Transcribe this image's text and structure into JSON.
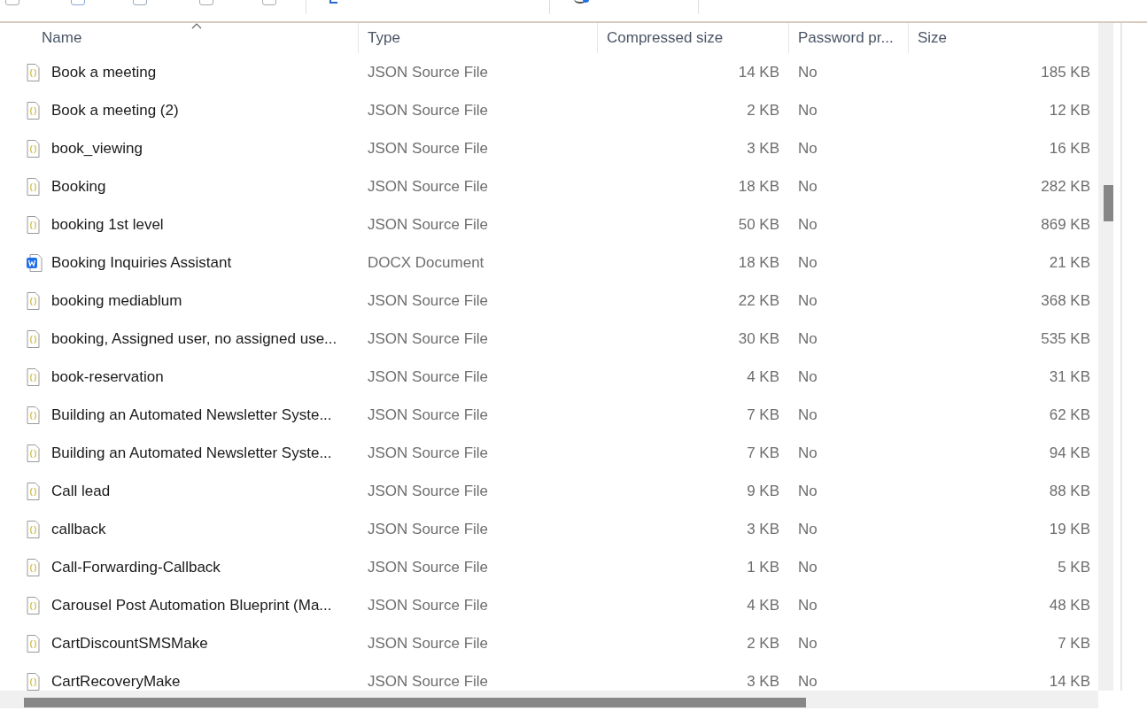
{
  "columns": [
    {
      "label": "Name",
      "sorted": true
    },
    {
      "label": "Type",
      "sorted": false
    },
    {
      "label": "Compressed size",
      "sorted": false
    },
    {
      "label": "Password pr...",
      "sorted": false
    },
    {
      "label": "Size",
      "sorted": false
    }
  ],
  "rows": [
    {
      "kind": "json",
      "name": "Book a meeting",
      "type": "JSON Source File",
      "compressed": "14 KB",
      "password": "No",
      "size": "185 KB"
    },
    {
      "kind": "json",
      "name": "Book a meeting (2)",
      "type": "JSON Source File",
      "compressed": "2 KB",
      "password": "No",
      "size": "12 KB"
    },
    {
      "kind": "json",
      "name": "book_viewing",
      "type": "JSON Source File",
      "compressed": "3 KB",
      "password": "No",
      "size": "16 KB"
    },
    {
      "kind": "json",
      "name": "Booking",
      "type": "JSON Source File",
      "compressed": "18 KB",
      "password": "No",
      "size": "282 KB"
    },
    {
      "kind": "json",
      "name": "booking 1st level",
      "type": "JSON Source File",
      "compressed": "50 KB",
      "password": "No",
      "size": "869 KB"
    },
    {
      "kind": "docx",
      "name": "Booking Inquiries Assistant",
      "type": "DOCX Document",
      "compressed": "18 KB",
      "password": "No",
      "size": "21 KB"
    },
    {
      "kind": "json",
      "name": "booking mediablum",
      "type": "JSON Source File",
      "compressed": "22 KB",
      "password": "No",
      "size": "368 KB"
    },
    {
      "kind": "json",
      "name": "booking, Assigned user, no assigned use...",
      "type": "JSON Source File",
      "compressed": "30 KB",
      "password": "No",
      "size": "535 KB"
    },
    {
      "kind": "json",
      "name": "book-reservation",
      "type": "JSON Source File",
      "compressed": "4 KB",
      "password": "No",
      "size": "31 KB"
    },
    {
      "kind": "json",
      "name": "Building an Automated Newsletter Syste...",
      "type": "JSON Source File",
      "compressed": "7 KB",
      "password": "No",
      "size": "62 KB"
    },
    {
      "kind": "json",
      "name": "Building an Automated Newsletter Syste...",
      "type": "JSON Source File",
      "compressed": "7 KB",
      "password": "No",
      "size": "94 KB"
    },
    {
      "kind": "json",
      "name": "Call lead",
      "type": "JSON Source File",
      "compressed": "9 KB",
      "password": "No",
      "size": "88 KB"
    },
    {
      "kind": "json",
      "name": "callback",
      "type": "JSON Source File",
      "compressed": "3 KB",
      "password": "No",
      "size": "19 KB"
    },
    {
      "kind": "json",
      "name": "Call-Forwarding-Callback",
      "type": "JSON Source File",
      "compressed": "1 KB",
      "password": "No",
      "size": "5 KB"
    },
    {
      "kind": "json",
      "name": "Carousel Post Automation Blueprint (Ma...",
      "type": "JSON Source File",
      "compressed": "4 KB",
      "password": "No",
      "size": "48 KB"
    },
    {
      "kind": "json",
      "name": "CartDiscountSMSMake",
      "type": "JSON Source File",
      "compressed": "2 KB",
      "password": "No",
      "size": "7 KB"
    },
    {
      "kind": "json",
      "name": "CartRecoveryMake",
      "type": "JSON Source File",
      "compressed": "3 KB",
      "password": "No",
      "size": "14 KB"
    }
  ]
}
